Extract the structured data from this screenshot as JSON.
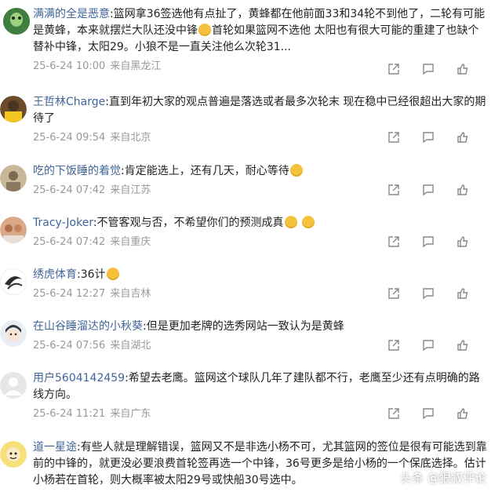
{
  "comments": [
    {
      "user": "满满的全是恶意",
      "parts": [
        "篮网拿36签选他有点扯了，黄蜂都在他前面33和34轮不到他了，二轮有可能是黄蜂，本来就摆烂大队还没中锋",
        "首轮如果篮网不选他 太阳也有很大可能的重建了也缺个替补中锋，太阳29。小狼不是一直关注他么次轮31..."
      ],
      "date": "25-6-24 10:00",
      "location": "来自黑龙江"
    },
    {
      "user": "王哲林Charge",
      "parts": [
        "直到年初大家的观点普遍是落选或者最多次轮末 现在稳中已经很超出大家的期待了"
      ],
      "date": "25-6-24 09:54",
      "location": "来自北京"
    },
    {
      "user": "吃的下饭睡的着觉",
      "parts": [
        "肯定能选上，还有几天，耐心等待"
      ],
      "date": "25-6-24 07:42",
      "location": "来自江苏"
    },
    {
      "user": "Tracy-Joker",
      "parts": [
        "不管客观与否，不希望你们的预测成真"
      ],
      "date": "25-6-24 07:42",
      "location": "来自重庆"
    },
    {
      "user": "绣虎体育",
      "parts": [
        "36计"
      ],
      "date": "25-6-24 12:27",
      "location": "来自吉林"
    },
    {
      "user": "在山谷睡溜达的小秋葵",
      "parts": [
        "但是更加老牌的选秀网站一致认为是黄蜂"
      ],
      "date": "25-6-24 07:56",
      "location": "来自湖北"
    },
    {
      "user": "用户5604142459",
      "parts": [
        "希望去老鹰。篮网这个球队几年了建队都不行，老鹰至少还有点明确的路线方向。"
      ],
      "date": "25-6-24 11:21",
      "location": "来自广东"
    },
    {
      "user": "道一星途",
      "parts": [
        "有些人就是理解错误，篮网又不是非选小杨不可，尤其篮网的签位是很有可能选到靠前的中锋的，就更没必要浪费首轮签再选一个中锋，36号更多是给小杨的一个保底选择。估计小杨若在首轮，则大概率被太阳29号或快船30号选中。"
      ],
      "date": "",
      "location": ""
    }
  ],
  "watermark": "头条 @狠叙评论"
}
